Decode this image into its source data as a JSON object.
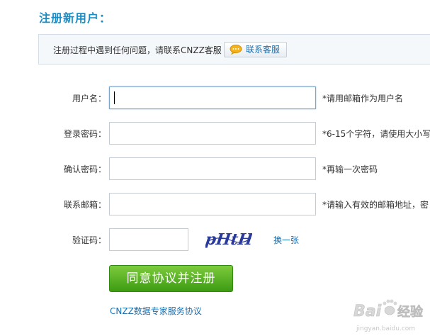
{
  "page": {
    "title": "注册新用户："
  },
  "notice": {
    "text": "注册过程中遇到任何问题，请联系CNZZ客服",
    "service_button": "联系客服"
  },
  "form": {
    "username": {
      "label": "用户名：",
      "value": "",
      "hint": "*请用邮箱作为用户名"
    },
    "password": {
      "label": "登录密码：",
      "value": "",
      "hint": "*6-15个字符，请使用大小写"
    },
    "confirm": {
      "label": "确认密码：",
      "value": "",
      "hint": "*再输一次密码"
    },
    "email": {
      "label": "联系邮箱：",
      "value": "",
      "hint": "*请输入有效的邮箱地址，密"
    },
    "captcha": {
      "label": "验证码：",
      "value": "",
      "image_text": "pHtH",
      "refresh_link": "换一张"
    },
    "submit_label": "同意协议并注册",
    "agreement_link": "CNZZ数据专家服务协议"
  },
  "watermark": {
    "brand": "Bai",
    "suffix": "经验",
    "url": "jingyan.baidu.com"
  },
  "colors": {
    "title": "#1a8dc6",
    "link": "#1a6fb0",
    "submit_top": "#7ccb3c",
    "submit_bottom": "#3d9b12"
  },
  "icons": {
    "service": "chat-bubble-icon",
    "watermark": "baidu-paw-icon"
  }
}
